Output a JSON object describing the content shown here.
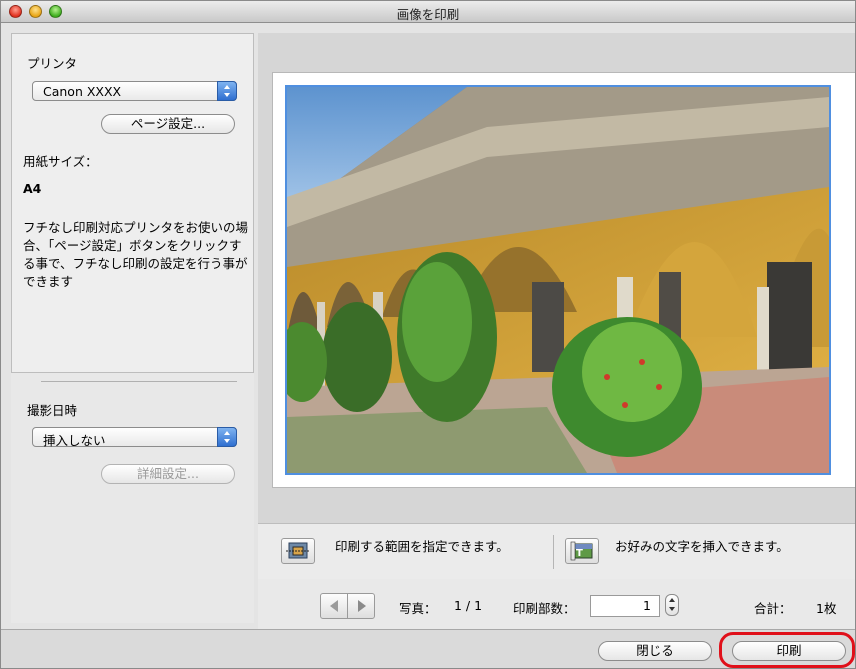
{
  "window": {
    "title": "画像を印刷"
  },
  "printer": {
    "label": "プリンタ",
    "selected": "Canon XXXX",
    "page_setup": "ページ設定..."
  },
  "paper": {
    "label": "用紙サイズ：",
    "value": "A4"
  },
  "description": "フチなし印刷対応プリンタをお使いの場合、「ページ設定」ボタンをクリックする事で、フチなし印刷の設定を行う事ができます",
  "shooting_date": {
    "label": "撮影日時",
    "selected": "挿入しない",
    "details": "詳細設定..."
  },
  "tools": {
    "crop_text": "印刷する範囲を指定できます。",
    "text_insert_text": "お好みの文字を挿入できます。"
  },
  "nav": {
    "photo_label": "写真：",
    "photo_value": "1 / 1",
    "copies_label": "印刷部数：",
    "copies_value": "1",
    "total_label": "合計：",
    "total_value": "1枚"
  },
  "buttons": {
    "close": "閉じる",
    "print": "印刷"
  },
  "icons": {
    "crop": "crop-range-icon",
    "text": "text-insert-icon",
    "prev": "triangle-left-icon",
    "next": "triangle-right-icon"
  },
  "colors": {
    "selection_border": "#4f8fe0",
    "highlight": "#e0101a",
    "popup_accent": "#2f6fd0"
  }
}
